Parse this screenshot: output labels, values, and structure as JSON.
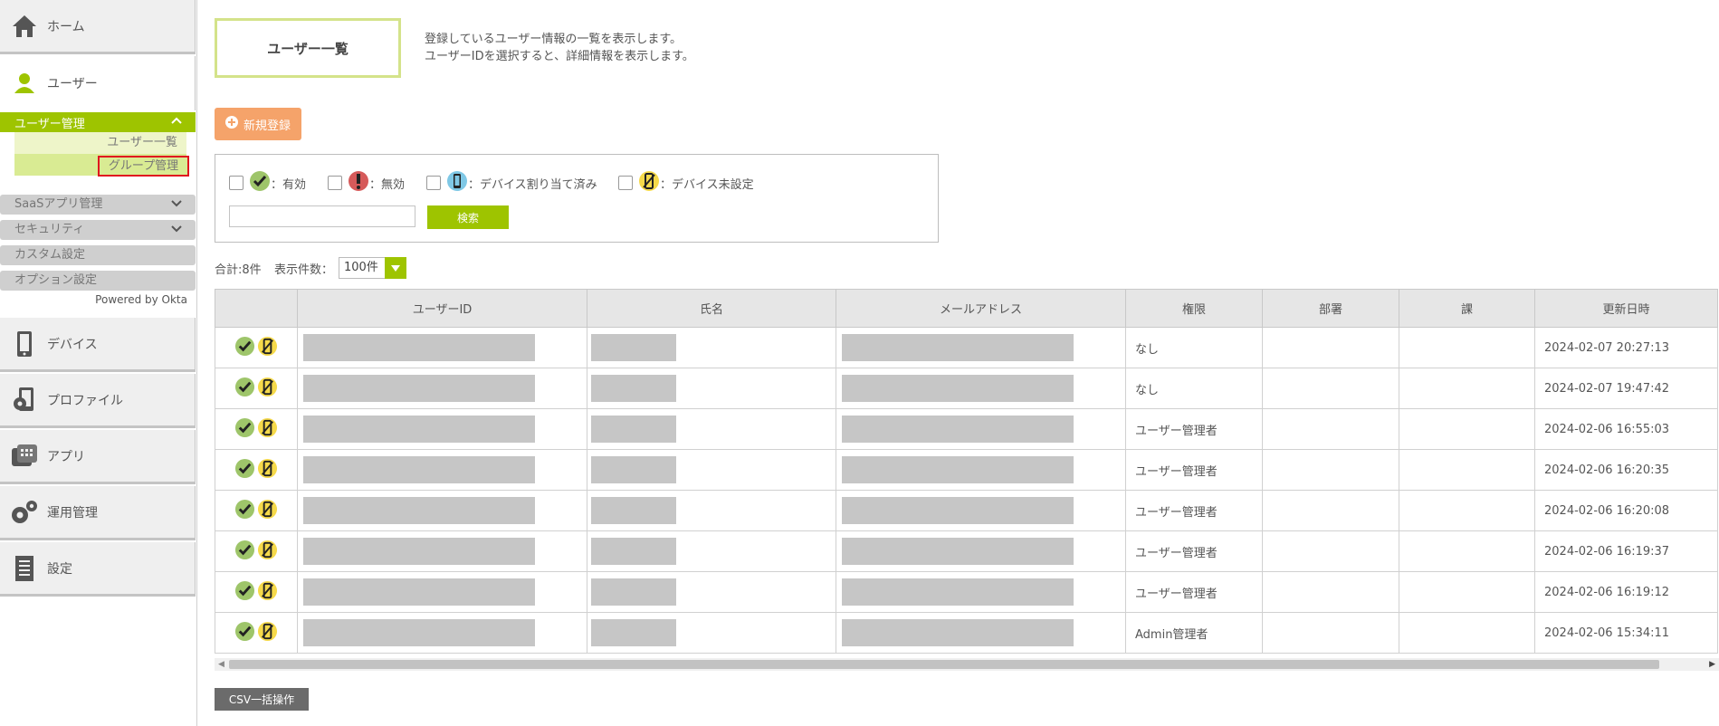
{
  "sidebar": {
    "home": "ホーム",
    "user": "ユーザー",
    "user_mgmt": "ユーザー管理",
    "user_list": "ユーザー一覧",
    "group_mgmt": "グループ管理",
    "saas": "SaaSアプリ管理",
    "security": "セキュリティ",
    "custom": "カスタム設定",
    "option": "オプション設定",
    "powered": "Powered by Okta",
    "device": "デバイス",
    "profile": "プロファイル",
    "app": "アプリ",
    "ops": "運用管理",
    "settings": "設定"
  },
  "header": {
    "title": "ユーザー一覧",
    "desc1": "登録しているユーザー情報の一覧を表示します。",
    "desc2": "ユーザーIDを選択すると、詳細情報を表示します。",
    "new_button": "新規登録"
  },
  "filter": {
    "active": "：有効",
    "inactive": "：無効",
    "assigned": "：デバイス割り当て済み",
    "unset": "：デバイス未設定",
    "search_button": "検索",
    "search_value": ""
  },
  "summary": {
    "total": "合計:8件",
    "per_page_label": "表示件数：",
    "per_page": "100件"
  },
  "table": {
    "headers": [
      "",
      "ユーザーID",
      "氏名",
      "メールアドレス",
      "権限",
      "部署",
      "課",
      "更新日時"
    ],
    "rows": [
      {
        "role": "なし",
        "updated": "2024-02-07 20:27:13"
      },
      {
        "role": "なし",
        "updated": "2024-02-07 19:47:42"
      },
      {
        "role": "ユーザー管理者",
        "updated": "2024-02-06 16:55:03"
      },
      {
        "role": "ユーザー管理者",
        "updated": "2024-02-06 16:20:35"
      },
      {
        "role": "ユーザー管理者",
        "updated": "2024-02-06 16:20:08"
      },
      {
        "role": "ユーザー管理者",
        "updated": "2024-02-06 16:19:37"
      },
      {
        "role": "ユーザー管理者",
        "updated": "2024-02-06 16:19:12"
      },
      {
        "role": "Admin管理者",
        "updated": "2024-02-06 15:34:11"
      }
    ]
  },
  "csv_button": "CSV一括操作",
  "colors": {
    "accent": "#9ec400",
    "new_button": "#f5a36a",
    "highlight_border": "#e0141e"
  }
}
